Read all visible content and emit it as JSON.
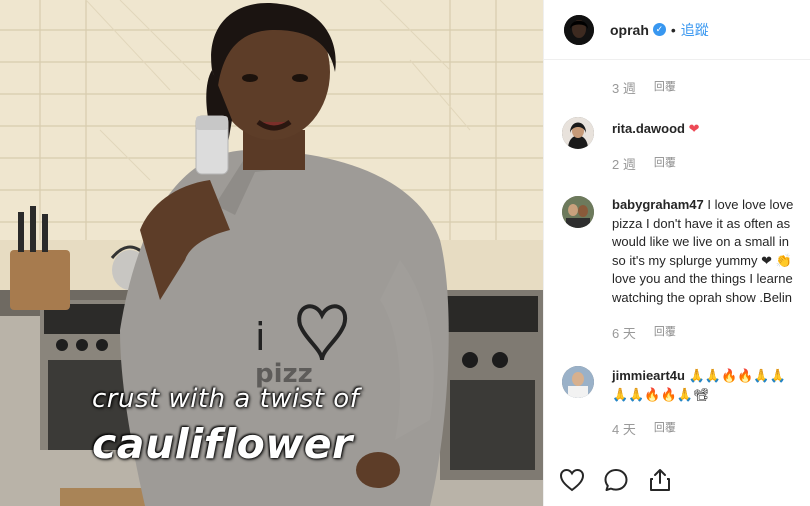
{
  "media": {
    "caption_line1": "crust with a twist of",
    "caption_line2": "cauliflower",
    "shirt_text": "i",
    "shirt_text2": "pizz"
  },
  "header": {
    "username": "oprah",
    "verified_icon": "check",
    "separator": "•",
    "follow_label": "追蹤"
  },
  "comments": [
    {
      "meta_time": "3 週",
      "reply": "回覆"
    },
    {
      "user": "rita.dawood",
      "text": "",
      "emoji": "❤",
      "time": "2 週",
      "reply": "回覆"
    },
    {
      "user": "babygraham47",
      "lines": [
        "I love love love",
        "pizza I don't have it as often as",
        "would like we live on a small in",
        "so it's my splurge yummy ❤ 👏",
        "love you and the things I learne",
        "watching the oprah show .Belin"
      ],
      "time": "6 天",
      "reply": "回覆"
    },
    {
      "user": "jimmieart4u",
      "lines": [
        "🙏🙏🔥🔥🙏🙏",
        "🙏🙏🔥🔥🙏📽"
      ],
      "time": "4 天",
      "reply": "回覆"
    }
  ],
  "actions": {
    "like": "heart-icon",
    "comment": "comment-icon",
    "share": "share-icon"
  }
}
